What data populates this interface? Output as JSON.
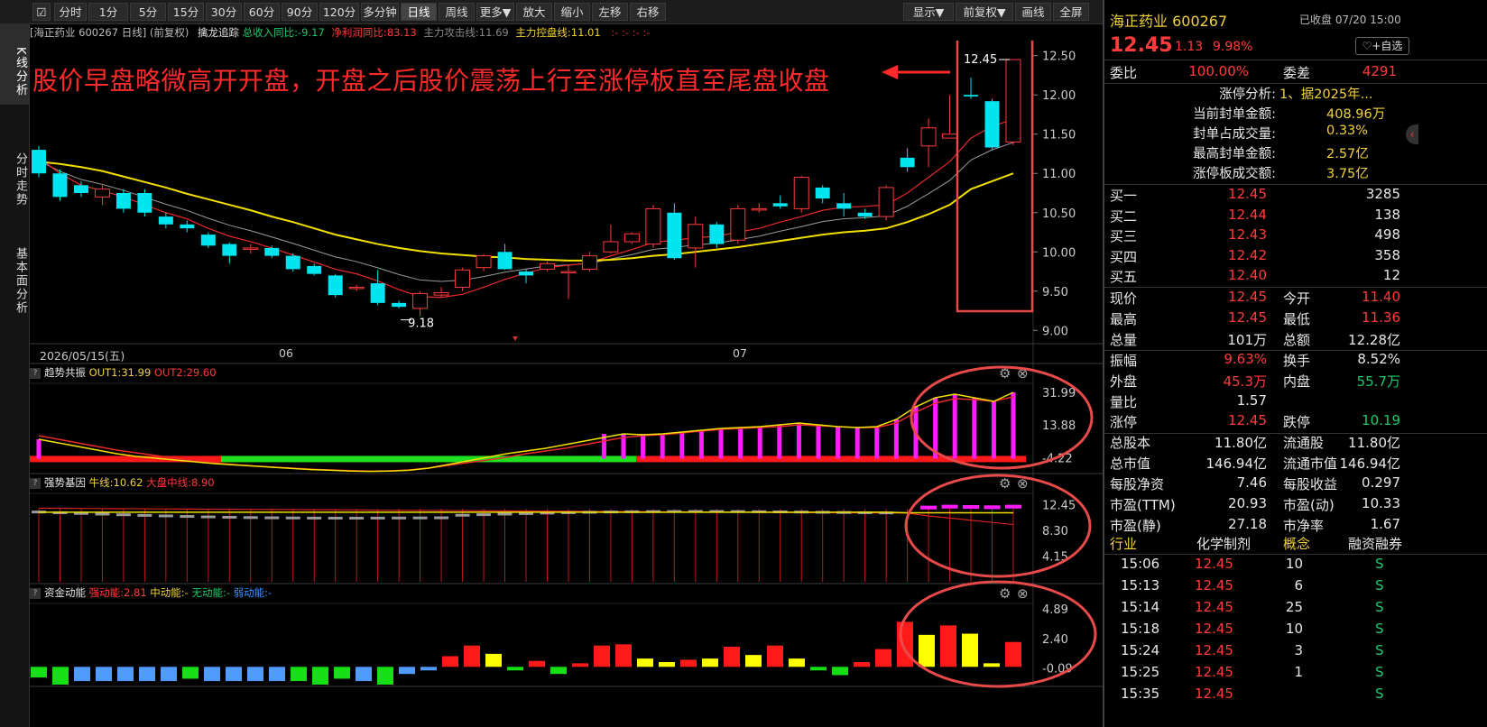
{
  "toolbar": {
    "left_buttons": [
      "分时",
      "1分",
      "5分",
      "15分",
      "30分",
      "60分",
      "90分",
      "120分",
      "多分钟",
      "日线",
      "周线",
      "更多▼",
      "放大",
      "缩小",
      "左移",
      "右移"
    ],
    "active": "日线",
    "right_buttons": [
      "显示▼",
      "前复权▼",
      "画线",
      "全屏"
    ]
  },
  "leftnav": [
    "K线分析",
    "分时走势",
    "基本面分析"
  ],
  "infobar": {
    "stock": "[海正药业 600267 日线]",
    "adjust": "(前复权)",
    "indicator": "擒龙追踪",
    "income_label": "总收入同比:",
    "income_value": "-9.17",
    "profit_label": "净利润同比:",
    "profit_value": "83.13",
    "attack_label": "主力攻击线:",
    "attack_value": "11.69",
    "control_label": "主力控盘线:",
    "control_value": "11.01",
    "extra": ":-  :-  :-  :-"
  },
  "annotation": "股价早盘略微高开开盘，开盘之后股价震荡上行至涨停板直至尾盘收盘",
  "chart_labels": {
    "high_label": "12.45",
    "low_label": "9.18",
    "date_start": "2026/05/15(五)",
    "month_06": "06",
    "month_07": "07"
  },
  "panels": {
    "trend": {
      "name": "趋势共振",
      "out1": "OUT1:31.99",
      "out2": "OUT2:29.60"
    },
    "gene": {
      "name": "强势基因",
      "bull": "牛线:10.62",
      "market": "大盘中线:8.90"
    },
    "fund": {
      "name": "资金动能",
      "strong": "强动能:2.81",
      "mid": "中动能:-",
      "none": "无动能:-",
      "weak": "弱动能:-"
    }
  },
  "colors": {
    "up": "#ff3b3b",
    "down": "#00e5f0",
    "ma_yellow": "#f1e000",
    "ma_red": "#e82a2a",
    "ma_gray": "#9a9a9a",
    "magenta": "#ff1dff",
    "annotation": "#ff2a2a",
    "highlight": "#e84a4a"
  },
  "chart_data": [
    {
      "type": "candlestick",
      "title": "海正药业 600267 日线",
      "ylim": [
        8.9,
        12.6
      ],
      "yticks": [
        "12.50",
        "12.00",
        "11.50",
        "11.00",
        "10.50",
        "10.00",
        "9.50",
        "9.00"
      ],
      "x_labels": [
        "2026/05/15(五)",
        "06",
        "07"
      ],
      "candles": [
        [
          11.3,
          11.0,
          11.35,
          10.95
        ],
        [
          11.0,
          10.7,
          11.05,
          10.65
        ],
        [
          10.85,
          10.75,
          10.9,
          10.7
        ],
        [
          10.7,
          10.8,
          10.85,
          10.6
        ],
        [
          10.75,
          10.55,
          10.8,
          10.5
        ],
        [
          10.75,
          10.5,
          10.8,
          10.45
        ],
        [
          10.45,
          10.35,
          10.5,
          10.3
        ],
        [
          10.35,
          10.3,
          10.4,
          10.25
        ],
        [
          10.22,
          10.08,
          10.25,
          10.05
        ],
        [
          10.1,
          9.95,
          10.12,
          9.85
        ],
        [
          10.05,
          10.05,
          10.1,
          9.98
        ],
        [
          10.05,
          9.95,
          10.08,
          9.92
        ],
        [
          9.95,
          9.78,
          9.98,
          9.75
        ],
        [
          9.82,
          9.72,
          9.85,
          9.7
        ],
        [
          9.7,
          9.45,
          9.72,
          9.42
        ],
        [
          9.55,
          9.55,
          9.58,
          9.5
        ],
        [
          9.6,
          9.35,
          9.77,
          9.32
        ],
        [
          9.35,
          9.3,
          9.38,
          9.28
        ],
        [
          9.28,
          9.47,
          9.5,
          9.18
        ],
        [
          9.45,
          9.48,
          9.55,
          9.42
        ],
        [
          9.55,
          9.77,
          9.8,
          9.5
        ],
        [
          9.8,
          9.95,
          9.97,
          9.75
        ],
        [
          10.0,
          9.78,
          10.1,
          9.77
        ],
        [
          9.75,
          9.7,
          9.78,
          9.6
        ],
        [
          9.78,
          9.85,
          9.88,
          9.75
        ],
        [
          9.75,
          9.75,
          9.83,
          9.4
        ],
        [
          9.78,
          9.95,
          10.0,
          9.75
        ],
        [
          10.0,
          10.13,
          10.35,
          9.98
        ],
        [
          10.13,
          10.23,
          10.25,
          10.1
        ],
        [
          10.1,
          10.55,
          10.6,
          10.05
        ],
        [
          10.5,
          9.92,
          10.62,
          9.9
        ],
        [
          10.05,
          10.35,
          10.45,
          9.8
        ],
        [
          10.35,
          10.1,
          10.38,
          10.05
        ],
        [
          10.15,
          10.55,
          10.6,
          10.1
        ],
        [
          10.55,
          10.55,
          10.62,
          10.5
        ],
        [
          10.62,
          10.58,
          10.72,
          10.55
        ],
        [
          10.55,
          10.95,
          10.97,
          10.5
        ],
        [
          10.82,
          10.68,
          10.85,
          10.62
        ],
        [
          10.62,
          10.55,
          10.75,
          10.45
        ],
        [
          10.5,
          10.45,
          10.55,
          10.42
        ],
        [
          10.45,
          10.82,
          10.85,
          10.4
        ],
        [
          11.2,
          11.08,
          11.32,
          11.02
        ],
        [
          11.35,
          11.58,
          11.7,
          11.08
        ],
        [
          11.45,
          11.5,
          12.0,
          11.45
        ],
        [
          12.0,
          11.98,
          12.22,
          11.95
        ],
        [
          11.92,
          11.33,
          11.95,
          11.3
        ],
        [
          11.4,
          12.45,
          12.45,
          11.36
        ]
      ],
      "ma_yellow": [
        11.15,
        11.12,
        11.08,
        11.03,
        10.96,
        10.89,
        10.82,
        10.74,
        10.67,
        10.6,
        10.53,
        10.45,
        10.38,
        10.3,
        10.22,
        10.16,
        10.1,
        10.05,
        10.01,
        9.98,
        9.96,
        9.94,
        9.93,
        9.91,
        9.9,
        9.89,
        9.89,
        9.9,
        9.92,
        9.95,
        9.97,
        10.0,
        10.03,
        10.06,
        10.1,
        10.14,
        10.18,
        10.22,
        10.25,
        10.27,
        10.3,
        10.38,
        10.48,
        10.6,
        10.8,
        10.9,
        11.0
      ],
      "ma_red": [
        11.2,
        11.0,
        10.85,
        10.78,
        10.7,
        10.6,
        10.5,
        10.42,
        10.3,
        10.2,
        10.13,
        10.05,
        9.96,
        9.87,
        9.78,
        9.72,
        9.63,
        9.52,
        9.43,
        9.42,
        9.46,
        9.55,
        9.65,
        9.73,
        9.8,
        9.83,
        9.86,
        9.95,
        10.03,
        10.12,
        10.15,
        10.18,
        10.2,
        10.25,
        10.3,
        10.38,
        10.45,
        10.53,
        10.57,
        10.58,
        10.6,
        10.75,
        10.95,
        11.15,
        11.45,
        11.6,
        11.69
      ]
    },
    {
      "type": "line+bar",
      "title": "趋势共振",
      "yticks": [
        "31.99",
        "13.88",
        "-4.22"
      ],
      "ylim": [
        -12,
        36
      ],
      "out1": [
        6,
        4,
        2,
        0,
        -2,
        -3.5,
        -4.5,
        -5.5,
        -6.5,
        -7.5,
        -8.2,
        -8.8,
        -9.5,
        -10.2,
        -10.8,
        -11.2,
        -11.6,
        -11.8,
        -11.6,
        -11.2,
        -10,
        -8,
        -6,
        -4,
        -2,
        -0.5,
        1,
        3,
        5,
        7,
        9,
        8.5,
        9,
        10,
        11,
        12,
        12.5,
        13,
        14,
        15,
        14,
        13,
        12.5,
        13,
        17,
        24,
        29,
        31,
        29,
        27,
        32
      ],
      "out2": [
        8,
        6,
        4,
        2,
        0,
        -1.5,
        -3,
        -4.5,
        -6,
        -7,
        -8,
        -8.8,
        -9.5,
        -10,
        -10.6,
        -11,
        -11.4,
        -11.6,
        -11.5,
        -11,
        -10,
        -8.5,
        -7,
        -5.5,
        -4,
        -2,
        -0.5,
        1,
        3,
        5,
        7,
        8,
        8.5,
        9.5,
        10.5,
        11.5,
        12,
        12.5,
        13,
        14,
        13.5,
        13,
        12.5,
        12.5,
        15,
        21,
        26,
        28.5,
        28,
        27,
        29.6
      ],
      "hist": [
        6,
        0,
        0,
        0,
        0,
        0,
        0,
        0,
        0,
        0,
        0,
        0,
        0,
        0,
        0,
        0,
        0,
        0,
        0,
        0,
        0,
        0,
        0,
        0,
        0,
        0,
        0,
        0,
        0,
        9,
        9,
        9,
        9,
        10,
        11,
        12,
        12,
        13,
        14,
        15,
        14,
        13,
        12.5,
        13,
        17,
        24,
        29,
        31,
        29,
        27,
        32
      ],
      "bar_colors_mode": [
        "red",
        "green",
        "red",
        "magenta"
      ]
    },
    {
      "type": "line+bar",
      "title": "强势基因",
      "yticks": [
        "12.45",
        "8.30",
        "4.15"
      ],
      "ylim": [
        0,
        14
      ],
      "bull_line": 10.62,
      "market_line": 8.9,
      "tail_bars": [
        12.3,
        12.45,
        12.4,
        12.35,
        12.45
      ]
    },
    {
      "type": "bar",
      "title": "资金动能",
      "yticks": [
        "4.89",
        "2.40",
        "-0.09"
      ],
      "ylim": [
        -1.5,
        5.2
      ],
      "values": [
        -0.9,
        -1.5,
        -1.2,
        -1.2,
        -1.2,
        -1.2,
        -1.2,
        -1.0,
        -1.2,
        -1.2,
        -1.2,
        -1.2,
        -1.2,
        -1.5,
        -1.0,
        -1.2,
        -1.5,
        -0.6,
        -0.3,
        0.9,
        1.8,
        1.1,
        -0.3,
        0.5,
        -0.6,
        0.3,
        1.8,
        1.9,
        0.7,
        0.4,
        0.6,
        0.7,
        1.7,
        1.0,
        1.8,
        0.7,
        -0.3,
        -0.7,
        0.4,
        1.5,
        3.8,
        2.7,
        3.5,
        2.8,
        0.3,
        2.1
      ],
      "colors": [
        "green",
        "green",
        "blue",
        "blue",
        "blue",
        "blue",
        "blue",
        "green",
        "blue",
        "blue",
        "blue",
        "blue",
        "green",
        "green",
        "green",
        "blue",
        "green",
        "blue",
        "blue",
        "red",
        "red",
        "yellow",
        "green",
        "red",
        "green",
        "red",
        "red",
        "red",
        "yellow",
        "yellow",
        "red",
        "yellow",
        "red",
        "yellow",
        "red",
        "yellow",
        "green",
        "green",
        "red",
        "red",
        "red",
        "yellow",
        "red",
        "yellow",
        "yellow",
        "red"
      ]
    }
  ],
  "right": {
    "title": "海正药业 600267",
    "status": "已收盘 07/20 15:00",
    "price": "12.45",
    "change": "1.13",
    "pct": "9.98%",
    "watch_btn": "+自选",
    "webi_label": "委比",
    "webi": "100.00%",
    "weicha_label": "委差",
    "weicha": "4291",
    "limit_rows": [
      {
        "label": "涨停分析:",
        "value": "1、据2025年..."
      },
      {
        "label": "当前封单金额:",
        "value": "408.96万"
      },
      {
        "label": "封单占成交量:",
        "value": "0.33%"
      },
      {
        "label": "最高封单金额:",
        "value": "2.57亿"
      },
      {
        "label": "涨停板成交额:",
        "value": "3.75亿"
      }
    ],
    "bids": [
      {
        "label": "买一",
        "price": "12.45",
        "vol": "3285"
      },
      {
        "label": "买二",
        "price": "12.44",
        "vol": "138"
      },
      {
        "label": "买三",
        "price": "12.43",
        "vol": "498"
      },
      {
        "label": "买四",
        "price": "12.42",
        "vol": "358"
      },
      {
        "label": "买五",
        "price": "12.40",
        "vol": "12"
      }
    ],
    "stats": [
      [
        {
          "l": "现价",
          "v": "12.45",
          "c": "red"
        },
        {
          "l": "今开",
          "v": "11.40",
          "c": "red"
        }
      ],
      [
        {
          "l": "最高",
          "v": "12.45",
          "c": "red"
        },
        {
          "l": "最低",
          "v": "11.36",
          "c": "red"
        }
      ],
      [
        {
          "l": "总量",
          "v": "101万",
          "c": "white"
        },
        {
          "l": "总额",
          "v": "12.28亿",
          "c": "white"
        }
      ],
      [
        {
          "l": "振幅",
          "v": "9.63%",
          "c": "red"
        },
        {
          "l": "换手",
          "v": "8.52%",
          "c": "white"
        }
      ],
      [
        {
          "l": "外盘",
          "v": "45.3万",
          "c": "red"
        },
        {
          "l": "内盘",
          "v": "55.7万",
          "c": "green"
        }
      ],
      [
        {
          "l": "量比",
          "v": "1.57",
          "c": "white"
        },
        {
          "l": "",
          "v": "",
          "c": "white"
        }
      ],
      [
        {
          "l": "涨停",
          "v": "12.45",
          "c": "red"
        },
        {
          "l": "跌停",
          "v": "10.19",
          "c": "green"
        }
      ],
      [
        {
          "l": "总股本",
          "v": "11.80亿",
          "c": "white"
        },
        {
          "l": "流通股",
          "v": "11.80亿",
          "c": "white"
        }
      ],
      [
        {
          "l": "总市值",
          "v": "146.94亿",
          "c": "white"
        },
        {
          "l": "流通市值",
          "v": "146.94亿",
          "c": "white"
        }
      ],
      [
        {
          "l": "每股净资",
          "v": "7.46",
          "c": "white"
        },
        {
          "l": "每股收益",
          "v": "0.297",
          "c": "white"
        }
      ],
      [
        {
          "l": "市盈(TTM)",
          "v": "20.93",
          "c": "white"
        },
        {
          "l": "市盈(动)",
          "v": "10.33",
          "c": "white"
        }
      ],
      [
        {
          "l": "市盈(静)",
          "v": "27.18",
          "c": "white"
        },
        {
          "l": "市净率",
          "v": "1.67",
          "c": "white"
        }
      ]
    ],
    "tags": [
      "行业",
      "化学制剂",
      "概念",
      "融资融券"
    ],
    "ticks": [
      {
        "time": "15:06",
        "price": "12.45",
        "vol": "10",
        "dir": "S"
      },
      {
        "time": "15:13",
        "price": "12.45",
        "vol": "6",
        "dir": "S"
      },
      {
        "time": "15:14",
        "price": "12.45",
        "vol": "25",
        "dir": "S"
      },
      {
        "time": "15:18",
        "price": "12.45",
        "vol": "10",
        "dir": "S"
      },
      {
        "time": "15:24",
        "price": "12.45",
        "vol": "3",
        "dir": "S"
      },
      {
        "time": "15:25",
        "price": "12.45",
        "vol": "1",
        "dir": "S"
      },
      {
        "time": "15:35",
        "price": "12.45",
        "vol": "",
        "dir": "S"
      }
    ]
  }
}
